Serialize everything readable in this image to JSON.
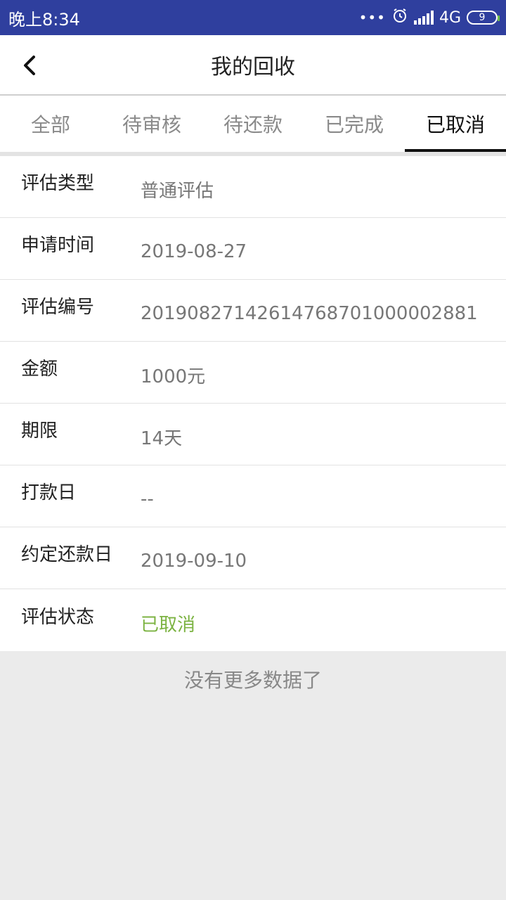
{
  "status": {
    "time": "晚上8:34",
    "network": "4G",
    "battery": "9"
  },
  "header": {
    "title": "我的回收"
  },
  "tabs": [
    {
      "label": "全部"
    },
    {
      "label": "待审核"
    },
    {
      "label": "待还款"
    },
    {
      "label": "已完成"
    },
    {
      "label": "已取消"
    }
  ],
  "detail": {
    "rows": [
      {
        "label": "评估类型",
        "value": "普通评估"
      },
      {
        "label": "申请时间",
        "value": "2019-08-27"
      },
      {
        "label": "评估编号",
        "value": "20190827142614768701000002881"
      },
      {
        "label": "金额",
        "value": "1000元"
      },
      {
        "label": "期限",
        "value": "14天"
      },
      {
        "label": "打款日",
        "value": "--"
      },
      {
        "label": "约定还款日",
        "value": "2019-09-10"
      },
      {
        "label": "评估状态",
        "value": "已取消"
      }
    ]
  },
  "footer": {
    "no_more": "没有更多数据了"
  },
  "colors": {
    "statusbar": "#2f3f9e",
    "status_green": "#7cb342"
  }
}
